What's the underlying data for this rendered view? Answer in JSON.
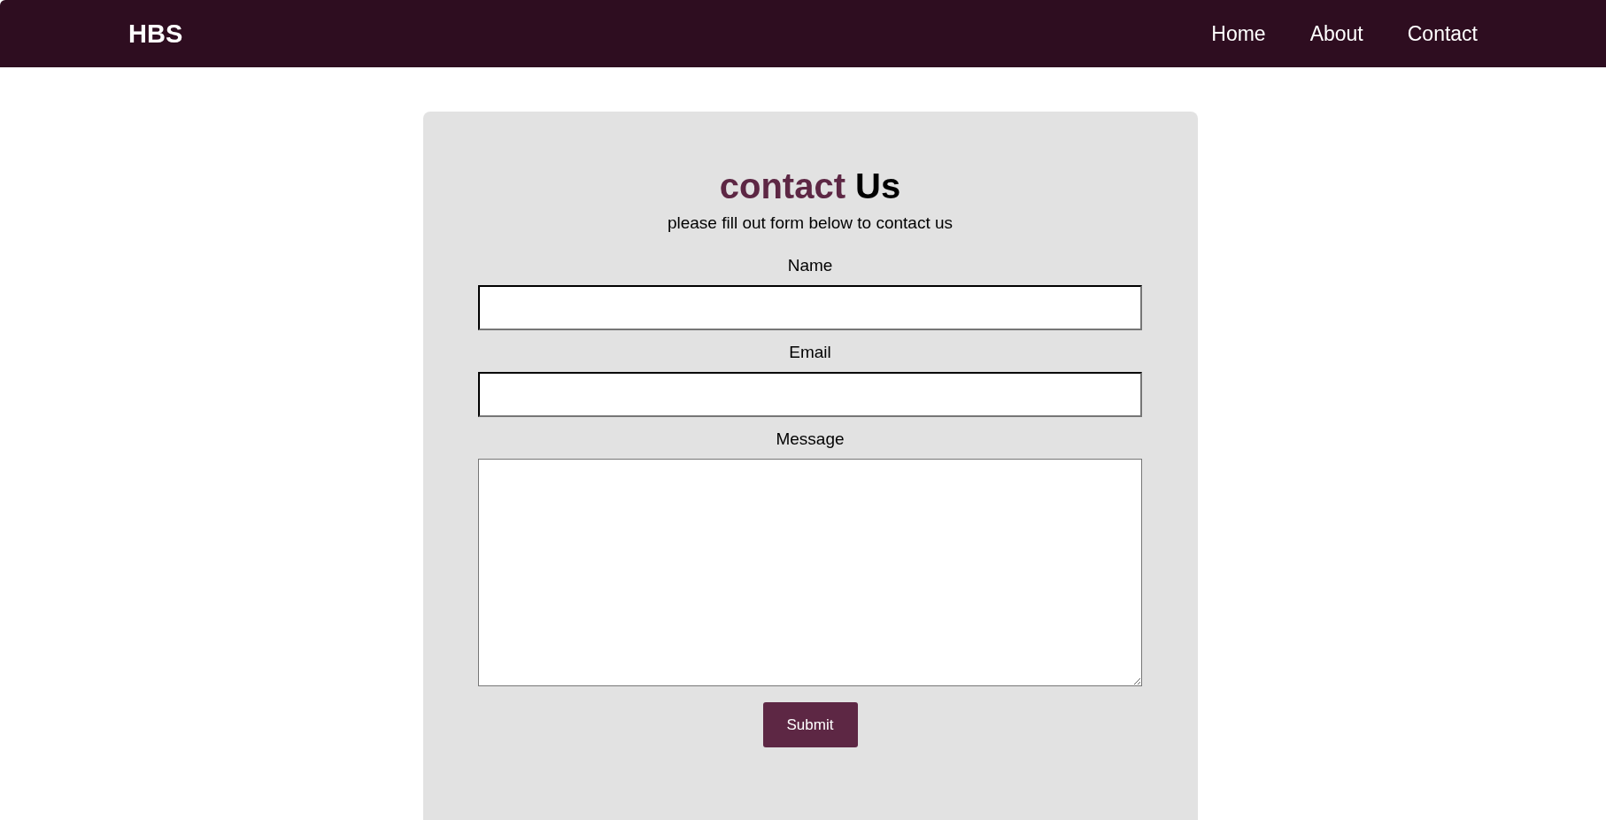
{
  "header": {
    "brand": "HBS",
    "nav": [
      {
        "label": "Home"
      },
      {
        "label": "About"
      },
      {
        "label": "Contact"
      }
    ]
  },
  "form": {
    "title": {
      "accent": "contact",
      "rest": "Us"
    },
    "subtitle": "please fill out form below to contact us",
    "fields": [
      {
        "kind": "input",
        "label": "Name"
      },
      {
        "kind": "input",
        "label": "Email"
      },
      {
        "kind": "textarea",
        "label": "Message"
      }
    ],
    "submit": "Submit"
  }
}
